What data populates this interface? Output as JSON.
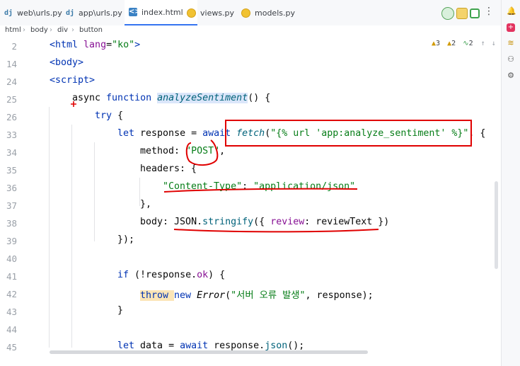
{
  "tabs": [
    {
      "label": "web\\urls.py",
      "icon": "django-icon",
      "active": false
    },
    {
      "label": "app\\urls.py",
      "icon": "django-icon",
      "active": false
    },
    {
      "label": "index.html",
      "icon": "html-file-icon",
      "active": true
    },
    {
      "label": "views.py",
      "icon": "python-file-icon",
      "active": false
    },
    {
      "label": "models.py",
      "icon": "python-file-icon",
      "active": false
    }
  ],
  "django_glyph": "dj",
  "html_glyph": "<>",
  "close_glyph": "×",
  "breadcrumb": [
    "html",
    "body",
    "div",
    "button"
  ],
  "inspections": {
    "warnings": "3",
    "weak_warnings": "2",
    "typos": "2"
  },
  "code": {
    "lines": [
      "2",
      "14",
      "24",
      "25",
      "26",
      "33",
      "34",
      "35",
      "36",
      "37",
      "38",
      "39",
      "40",
      "41",
      "42",
      "43",
      "44",
      "45"
    ],
    "l2_a": "<html ",
    "l2_b": "lang",
    "l2_c": "=",
    "l2_d": "\"ko\"",
    "l2_e": ">",
    "l14": "<body>",
    "l24": "<script>",
    "l25_a": "async ",
    "l25_b": "function ",
    "l25_c": "analyzeSentiment",
    "l25_d": "() {",
    "l26_a": "try",
    "l26_b": " {",
    "l33_a": "let ",
    "l33_b": "response",
    "l33_c": " = ",
    "l33_d": "await ",
    "l33_e": "fetch",
    "l33_f": "(",
    "l33_g": "\"{% url 'app:analyze_sentiment' %}\"",
    "l33_h": ", {",
    "l34_a": "method",
    "l34_b": ": ",
    "l34_c": "\"POST\"",
    "l34_d": ",",
    "l35_a": "headers",
    "l35_b": ": {",
    "l36_a": "\"Content-Type\"",
    "l36_b": ": ",
    "l36_c": "\"application/json\"",
    "l37": "},",
    "l38_a": "body",
    "l38_b": ": ",
    "l38_c": "JSON",
    "l38_d": ".",
    "l38_e": "stringify",
    "l38_f": "({ ",
    "l38_g": "review",
    "l38_h": ": reviewText })",
    "l39": "});",
    "l41_a": "if ",
    "l41_b": "(!response.",
    "l41_c": "ok",
    "l41_d": ") {",
    "l42_a": "throw ",
    "l42_b": "new ",
    "l42_c": "Error",
    "l42_d": "(",
    "l42_e": "\"서버 오류 발생\"",
    "l42_f": ", response);",
    "l43": "}",
    "l45_a": "let ",
    "l45_b": "data",
    "l45_c": " = ",
    "l45_d": "await ",
    "l45_e": "response.",
    "l45_f": "json",
    "l45_g": "();"
  },
  "colors": {
    "keyword": "#0033b3",
    "string": "#067d17",
    "function": "#00627a",
    "property": "#871094",
    "annotation": "#e00000",
    "accent": "#3574f0"
  }
}
